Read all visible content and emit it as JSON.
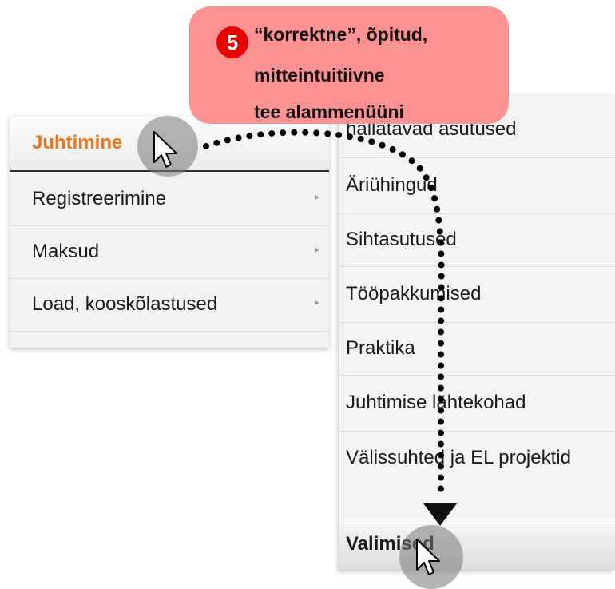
{
  "left_menu": {
    "items": [
      {
        "label": "Juhtimine",
        "active": true
      },
      {
        "label": "Registreerimine",
        "arrow": "▸"
      },
      {
        "label": "Maksud",
        "arrow": "▸"
      },
      {
        "label": "Load, kooskõlastused",
        "arrow": "▸"
      }
    ]
  },
  "sub_menu": {
    "items": [
      {
        "label": "hallatavad asutused"
      },
      {
        "label": "Äriühingud"
      },
      {
        "label": "Sihtasutused"
      },
      {
        "label": "Tööpakkumised"
      },
      {
        "label": "Praktika"
      },
      {
        "label": "Juhtimise lähtekohad"
      },
      {
        "label": "Välissuhted ja EL projektid"
      },
      {
        "label": "Valimised",
        "active": true
      }
    ]
  },
  "callout": {
    "number": "5",
    "line1": "“korrektne”, õpitud,",
    "line2": "mitteintuitiivne",
    "line3": "tee alammenüüni",
    "color": "#fc8e8e",
    "badge_color": "#e60000"
  },
  "colors": {
    "active_label": "#e8761c",
    "menu_bg": "#f2f2f2",
    "path_dots": "#000000"
  },
  "icons": {
    "cursor": "cursor-arrow-icon",
    "arrowhead": "arrowhead-down-icon"
  }
}
